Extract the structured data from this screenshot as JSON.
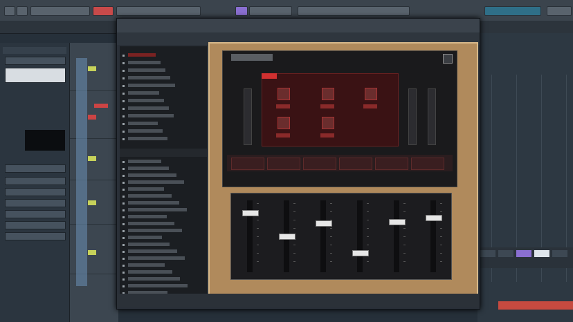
{
  "plugin": {
    "browser_items_top": [
      "",
      "",
      "",
      "",
      "",
      "",
      "",
      "",
      "",
      "",
      "",
      ""
    ],
    "browser_items_bottom": [
      "",
      "",
      "",
      "",
      "",
      "",
      "",
      "",
      "",
      "",
      "",
      "",
      "",
      "",
      "",
      "",
      "",
      "",
      "",
      ""
    ],
    "selected_index": 0,
    "fader_levels": [
      0.85,
      0.5,
      0.7,
      0.25,
      0.72,
      0.78
    ]
  },
  "colors": {
    "accent_red": "#d03030",
    "highlight_yellow": "#c7d25a",
    "track_blue": "#6a90b4"
  }
}
